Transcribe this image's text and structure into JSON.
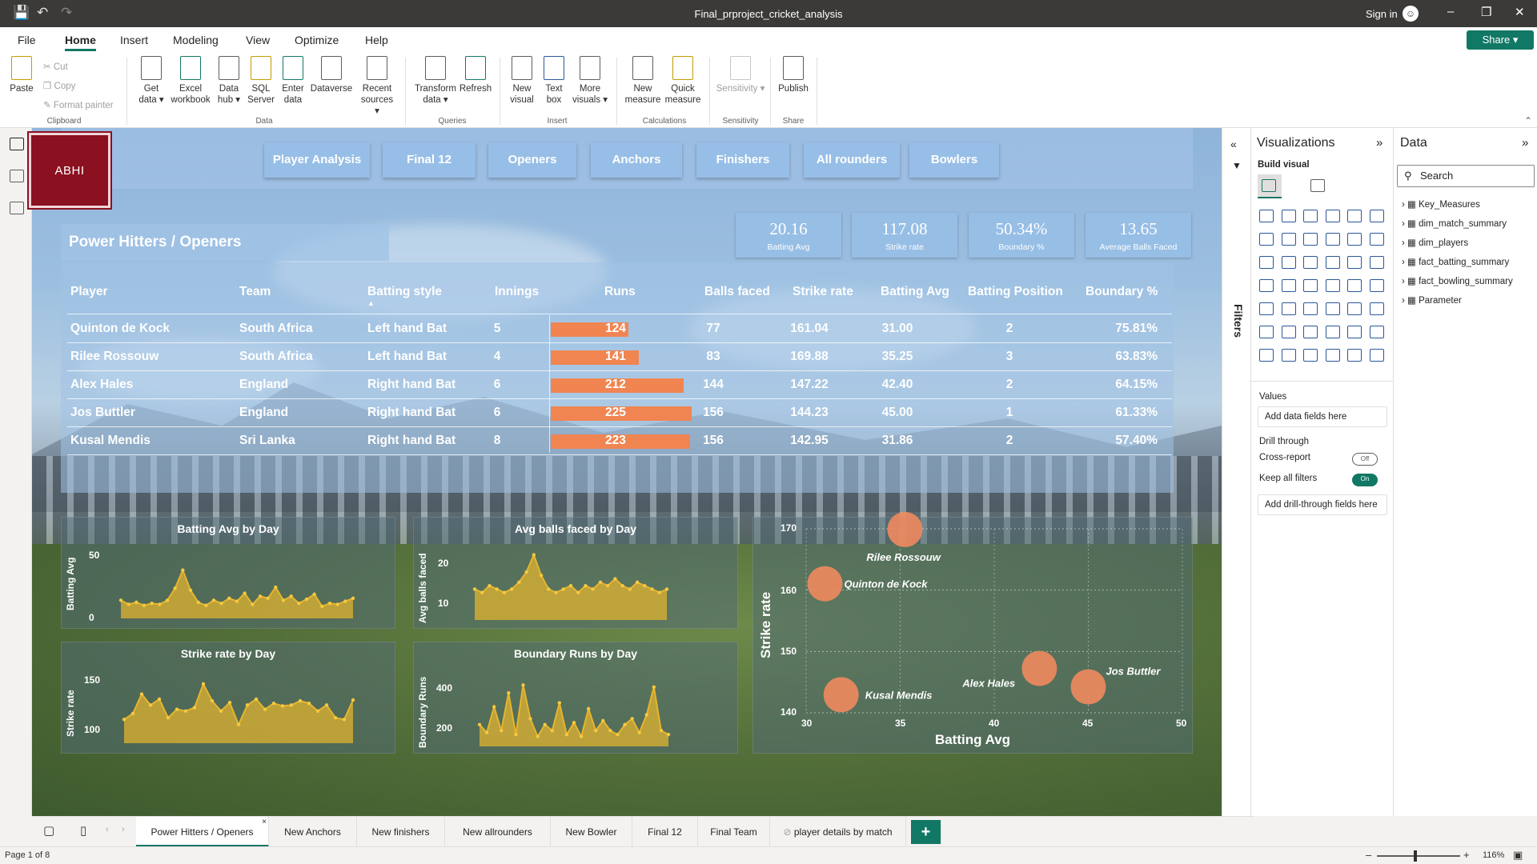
{
  "window": {
    "title": "Final_prproject_cricket_analysis",
    "sign_in": "Sign in"
  },
  "menu": [
    "File",
    "Home",
    "Insert",
    "Modeling",
    "View",
    "Optimize",
    "Help"
  ],
  "share_label": "Share",
  "ribbon": {
    "paste": "Paste",
    "cut": "Cut",
    "copy": "Copy",
    "format_painter": "Format painter",
    "buttons": [
      "Get data",
      "Excel workbook",
      "Data hub",
      "SQL Server",
      "Enter data",
      "Dataverse",
      "Recent sources",
      "Transform data",
      "Refresh",
      "New visual",
      "Text box",
      "More visuals",
      "New measure",
      "Quick measure",
      "Sensitivity",
      "Publish"
    ],
    "groups": [
      "Clipboard",
      "Data",
      "Queries",
      "Insert",
      "Calculations",
      "Sensitivity",
      "Share"
    ]
  },
  "report": {
    "logo_text": "ABHI",
    "nav": [
      "Player Analysis",
      "Final 12",
      "Openers",
      "Anchors",
      "Finishers",
      "All rounders",
      "Bowlers"
    ],
    "page_title": "Power Hitters / Openers",
    "kpis": [
      {
        "value": "20.16",
        "label": "Batting Avg"
      },
      {
        "value": "117.08",
        "label": "Strike rate"
      },
      {
        "value": "50.34%",
        "label": "Boundary %"
      },
      {
        "value": "13.65",
        "label": "Average Balls Faced"
      }
    ],
    "table": {
      "columns": [
        "Player",
        "Team",
        "Batting style",
        "Innings",
        "Runs",
        "Balls faced",
        "Strike rate",
        "Batting Avg",
        "Batting Position",
        "Boundary %"
      ],
      "rows": [
        [
          "Quinton de Kock",
          "South Africa",
          "Left hand Bat",
          "5",
          "124",
          "77",
          "161.04",
          "31.00",
          "2",
          "75.81%"
        ],
        [
          "Rilee Rossouw",
          "South Africa",
          "Left hand Bat",
          "4",
          "141",
          "83",
          "169.88",
          "35.25",
          "3",
          "63.83%"
        ],
        [
          "Alex Hales",
          "England",
          "Right hand Bat",
          "6",
          "212",
          "144",
          "147.22",
          "42.40",
          "2",
          "64.15%"
        ],
        [
          "Jos Buttler",
          "England",
          "Right hand Bat",
          "6",
          "225",
          "156",
          "144.23",
          "45.00",
          "1",
          "61.33%"
        ],
        [
          "Kusal Mendis",
          "Sri Lanka",
          "Right hand Bat",
          "8",
          "223",
          "156",
          "142.95",
          "31.86",
          "2",
          "57.40%"
        ]
      ],
      "runs_values": [
        124,
        141,
        212,
        225,
        223
      ]
    },
    "charts": {
      "batting_avg": {
        "title": "Batting Avg by Day",
        "ylabel": "Batting Avg",
        "yticks": [
          "50",
          "0"
        ]
      },
      "balls_faced": {
        "title": "Avg balls faced by Day",
        "ylabel": "Avg balls faced",
        "yticks": [
          "20",
          "10"
        ]
      },
      "strike_rate": {
        "title": "Strike rate by Day",
        "ylabel": "Strike rate",
        "yticks": [
          "150",
          "100"
        ]
      },
      "boundary_runs": {
        "title": "Boundary Runs by Day",
        "ylabel": "Boundary Runs",
        "yticks": [
          "400",
          "200"
        ]
      },
      "scatter": {
        "xlabel": "Batting Avg",
        "ylabel": "Strike rate",
        "xticks": [
          "30",
          "35",
          "40",
          "45",
          "50"
        ],
        "yticks": [
          "170",
          "160",
          "150",
          "140"
        ]
      }
    }
  },
  "chart_data": [
    {
      "type": "area",
      "title": "Batting Avg by Day",
      "ylabel": "Batting Avg",
      "ylim": [
        0,
        70
      ],
      "values": [
        18,
        14,
        16,
        13,
        15,
        14,
        18,
        30,
        48,
        28,
        16,
        13,
        18,
        15,
        20,
        17,
        25,
        14,
        22,
        20,
        31,
        18,
        22,
        15,
        19,
        24,
        12,
        15,
        14,
        17,
        20
      ]
    },
    {
      "type": "area",
      "title": "Avg balls faced by Day",
      "ylabel": "Avg balls faced",
      "ylim": [
        5,
        26
      ],
      "values": [
        14,
        13,
        15,
        14,
        13,
        14,
        16,
        19,
        24,
        18,
        14,
        13,
        14,
        15,
        13,
        15,
        14,
        16,
        15,
        17,
        15,
        14,
        16,
        15,
        14,
        13,
        14
      ]
    },
    {
      "type": "area",
      "title": "Strike rate by Day",
      "ylabel": "Strike rate",
      "ylim": [
        80,
        165
      ],
      "values": [
        108,
        115,
        138,
        125,
        132,
        110,
        120,
        118,
        122,
        150,
        130,
        118,
        128,
        102,
        125,
        132,
        120,
        127,
        124,
        125,
        130,
        127,
        118,
        125,
        110,
        108,
        131
      ]
    },
    {
      "type": "area",
      "title": "Boundary Runs by Day",
      "ylabel": "Boundary Runs",
      "ylim": [
        120,
        500
      ],
      "values": [
        230,
        190,
        320,
        200,
        390,
        180,
        430,
        260,
        170,
        230,
        200,
        340,
        180,
        240,
        170,
        310,
        200,
        250,
        200,
        180,
        230,
        260,
        190,
        280,
        420,
        200,
        180
      ]
    },
    {
      "type": "scatter",
      "xlabel": "Batting Avg",
      "ylabel": "Strike rate",
      "xlim": [
        30,
        50
      ],
      "ylim": [
        140,
        170
      ],
      "points": [
        {
          "label": "Quinton de Kock",
          "x": 31.0,
          "y": 161.04
        },
        {
          "label": "Rilee Rossouw",
          "x": 35.25,
          "y": 169.88
        },
        {
          "label": "Alex Hales",
          "x": 42.4,
          "y": 147.22
        },
        {
          "label": "Jos Buttler",
          "x": 45.0,
          "y": 144.23
        },
        {
          "label": "Kusal Mendis",
          "x": 31.86,
          "y": 142.95
        }
      ]
    }
  ],
  "tabs": [
    "Power Hitters / Openers",
    "New Anchors",
    "New finishers",
    "New allrounders",
    "New Bowler",
    "Final 12",
    "Final Team",
    "player details by match"
  ],
  "status": {
    "page": "Page 1 of 8",
    "zoom": "116%"
  },
  "viz_pane": {
    "title": "Visualizations",
    "build_visual": "Build visual",
    "values": "Values",
    "add_data": "Add data fields here",
    "drill": "Drill through",
    "cross_report": "Cross-report",
    "cross_state": "Off",
    "keep_filters": "Keep all filters",
    "keep_state": "On",
    "add_drill": "Add drill-through fields here"
  },
  "filters_label": "Filters",
  "data_pane": {
    "title": "Data",
    "search": "Search",
    "items": [
      "Key_Measures",
      "dim_match_summary",
      "dim_players",
      "fact_batting_summary",
      "fact_bowling_summary",
      "Parameter"
    ]
  },
  "colors": {
    "accent": "#117865",
    "bar": "#f08552",
    "area": "#e6b52e",
    "bubble": "#ef8a5e"
  }
}
